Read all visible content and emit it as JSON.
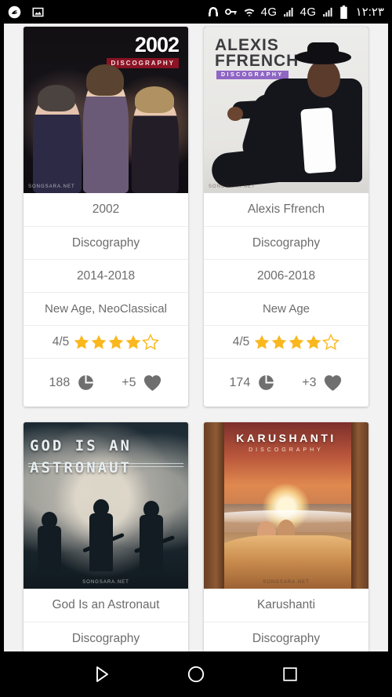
{
  "status_bar": {
    "time": "۱۲:۲۳",
    "left_icons": [
      {
        "name": "app-logo-icon",
        "glyph": "logo"
      },
      {
        "name": "gallery-image-icon",
        "glyph": "image"
      }
    ],
    "right_icons": [
      {
        "name": "headphones-icon",
        "glyph": "headphones"
      },
      {
        "name": "vpn-key-icon",
        "glyph": "key"
      },
      {
        "name": "wifi-icon",
        "glyph": "wifi"
      },
      {
        "name": "network-4g-sim1-label",
        "glyph": "4G"
      },
      {
        "name": "signal-bars-sim1-icon",
        "glyph": "signal"
      },
      {
        "name": "network-4g-sim2-label",
        "glyph": "4G"
      },
      {
        "name": "signal-bars-sim2-icon",
        "glyph": "signal"
      },
      {
        "name": "battery-icon",
        "glyph": "battery"
      }
    ],
    "network_label_1": "4G",
    "network_label_2": "4G"
  },
  "cards": [
    {
      "cover": {
        "style": "2002",
        "title": "2002",
        "subtitle": "DISCOGRAPHY",
        "watermark": "SONGSARA.NET"
      },
      "artist": "2002",
      "type": "Discography",
      "years": "2014-2018",
      "genre": "New Age, NeoClassical",
      "rating_text": "4/5",
      "rating_value": 4,
      "rating_max": 5,
      "views": "188",
      "likes": "+5"
    },
    {
      "cover": {
        "style": "alexis",
        "title_line1": "ALEXIS",
        "title_line2": "FFRENCH",
        "subtitle": "DISCOGRAPHY",
        "watermark": "SONGSARA.NET"
      },
      "artist": "Alexis Ffrench",
      "type": "Discography",
      "years": "2006-2018",
      "genre": "New Age",
      "rating_text": "4/5",
      "rating_value": 4,
      "rating_max": 5,
      "views": "174",
      "likes": "+3"
    },
    {
      "cover": {
        "style": "god",
        "title_line1": "GOD IS AN",
        "title_line2": "ASTRONAUT",
        "watermark": "SONGSARA.NET"
      },
      "artist": "God Is an Astronaut",
      "type": "Discography"
    },
    {
      "cover": {
        "style": "karushanti",
        "title": "KARUSHANTI",
        "subtitle": "DISCOGRAPHY",
        "watermark": "SONGSARA.NET"
      },
      "artist": "Karushanti",
      "type": "Discography"
    }
  ],
  "nav_bar": {
    "back_label": "back-button",
    "home_label": "home-button",
    "recents_label": "recents-button"
  },
  "colors": {
    "star_filled": "#fab81e",
    "page_background": "#f2f2f2",
    "card_background": "#ffffff",
    "text": "#6c6c6c",
    "accent_red": "#8a1324",
    "accent_purple": "#8f66c4"
  }
}
